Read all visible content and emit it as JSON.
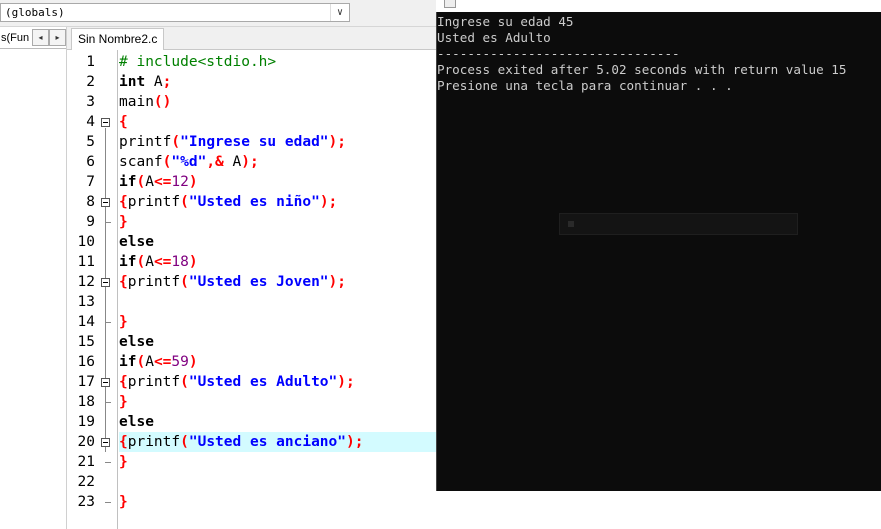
{
  "toolbar": {
    "globals_value": "(globals)",
    "dropdown_arrow": "∨"
  },
  "left_panel": {
    "tab_label": "s(Fun",
    "nav_prev": "◂",
    "nav_next": "▸"
  },
  "editor": {
    "file_tab": "Sin Nombre2.c",
    "highlight_line": 20,
    "lines": [
      {
        "n": "1"
      },
      {
        "n": "2"
      },
      {
        "n": "3"
      },
      {
        "n": "4"
      },
      {
        "n": "5"
      },
      {
        "n": "6"
      },
      {
        "n": "7"
      },
      {
        "n": "8"
      },
      {
        "n": "9"
      },
      {
        "n": "10"
      },
      {
        "n": "11"
      },
      {
        "n": "12"
      },
      {
        "n": "13"
      },
      {
        "n": "14"
      },
      {
        "n": "15"
      },
      {
        "n": "16"
      },
      {
        "n": "17"
      },
      {
        "n": "18"
      },
      {
        "n": "19"
      },
      {
        "n": "20"
      },
      {
        "n": "21"
      },
      {
        "n": "22"
      },
      {
        "n": "23"
      }
    ],
    "code": {
      "l1_directive": "# include<stdio.h>",
      "l2_kw": "int",
      "l2_rest": " A",
      "l2_semi": ";",
      "l3_fn": "main",
      "l3_parens": "()",
      "l4_brace": "{",
      "l5_fn": "printf",
      "l5_open": "(",
      "l5_str": "\"Ingrese su edad\"",
      "l5_close": ");",
      "l6_fn": "scanf",
      "l6_open": "(",
      "l6_str": "\"%d\"",
      "l6_amp": ",&",
      "l6_var": " A",
      "l6_close": ");",
      "l7_kw": "if",
      "l7_open": "(",
      "l7_var": "A",
      "l7_op": "<=",
      "l7_num": "12",
      "l7_close": ")",
      "l8_brace": "{",
      "l8_fn": "printf",
      "l8_open": "(",
      "l8_str": "\"Usted es niño\"",
      "l8_close": ");",
      "l9_brace": "}",
      "l10_kw": "else",
      "l11_kw": "if",
      "l11_open": "(",
      "l11_var": "A",
      "l11_op": "<=",
      "l11_num": "18",
      "l11_close": ")",
      "l12_brace": "{",
      "l12_fn": "printf",
      "l12_open": "(",
      "l12_str": "\"Usted es Joven\"",
      "l12_close": ");",
      "l14_brace": "}",
      "l15_kw": "else",
      "l16_kw": "if",
      "l16_open": "(",
      "l16_var": "A",
      "l16_op": "<=",
      "l16_num": "59",
      "l16_close": ")",
      "l17_brace": "{",
      "l17_fn": "printf",
      "l17_open": "(",
      "l17_str": "\"Usted es Adulto\"",
      "l17_close": ");",
      "l18_brace": "}",
      "l19_kw": "else",
      "l20_brace": "{",
      "l20_fn": "printf",
      "l20_open": "(",
      "l20_str": "\"Usted es anciano\"",
      "l20_close": ");",
      "l21_brace": "}",
      "l23_brace": "}"
    }
  },
  "console": {
    "lines": [
      "Ingrese su edad 45",
      "Usted es Adulto",
      "--------------------------------",
      "Process exited after 5.02 seconds with return value 15",
      "Presione una tecla para continuar . . ."
    ]
  },
  "colors": {
    "keyword": "#000000",
    "string": "#0000ff",
    "number": "#800080",
    "directive": "#008000",
    "symbol": "#ff0000",
    "highlight": "#d3fbff",
    "console_bg": "#0c0c0c",
    "console_fg": "#cccccc"
  }
}
